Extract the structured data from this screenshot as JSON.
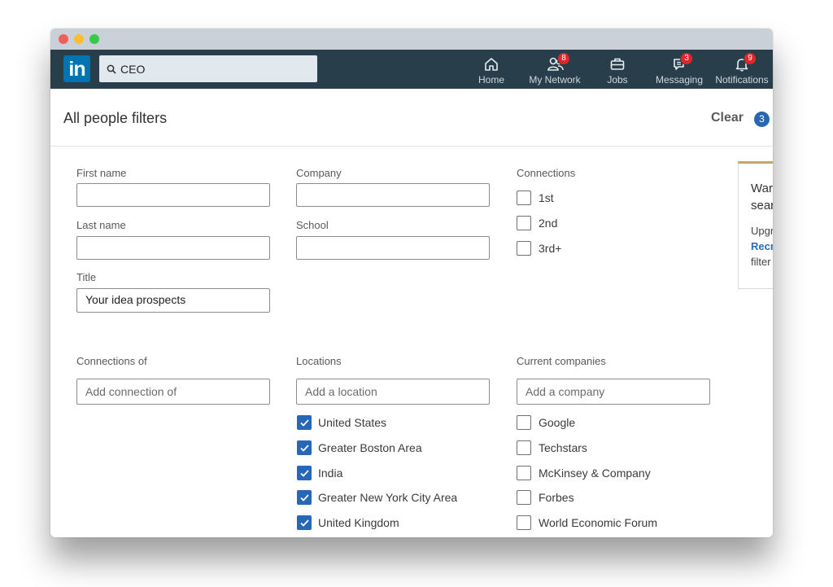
{
  "nav": {
    "logo_text": "in",
    "search_value": "CEO",
    "items": [
      {
        "label": "Home",
        "icon": "home-icon"
      },
      {
        "label": "My Network",
        "icon": "network-icon",
        "badge": "8"
      },
      {
        "label": "Jobs",
        "icon": "briefcase-icon"
      },
      {
        "label": "Messaging",
        "icon": "messaging-icon",
        "badge": "3"
      },
      {
        "label": "Notifications",
        "icon": "bell-icon",
        "badge": "9"
      }
    ],
    "colors": {
      "bar": "#283e4a",
      "logo": "#0073b1",
      "badge": "#e0262a"
    }
  },
  "header": {
    "title": "All people filters",
    "clear_label": "Clear",
    "clear_count": "3"
  },
  "fields": {
    "first_name_label": "First name",
    "last_name_label": "Last name",
    "title_label": "Title",
    "title_value": "Your idea prospects",
    "company_label": "Company",
    "school_label": "School"
  },
  "connections": {
    "label": "Connections",
    "options": [
      {
        "label": "1st",
        "checked": false
      },
      {
        "label": "2nd",
        "checked": false
      },
      {
        "label": "3rd+",
        "checked": false
      }
    ]
  },
  "connections_of": {
    "label": "Connections of",
    "placeholder": "Add connection of"
  },
  "locations": {
    "label": "Locations",
    "placeholder": "Add a location",
    "options": [
      {
        "label": "United States",
        "checked": true
      },
      {
        "label": "Greater Boston Area",
        "checked": true
      },
      {
        "label": "India",
        "checked": true
      },
      {
        "label": "Greater New York City Area",
        "checked": true
      },
      {
        "label": "United Kingdom",
        "checked": true
      }
    ]
  },
  "current_companies": {
    "label": "Current companies",
    "placeholder": "Add a company",
    "options": [
      {
        "label": "Google",
        "checked": false
      },
      {
        "label": "Techstars",
        "checked": false
      },
      {
        "label": "McKinsey & Company",
        "checked": false
      },
      {
        "label": "Forbes",
        "checked": false
      },
      {
        "label": "World Economic Forum",
        "checked": false
      }
    ]
  },
  "promo": {
    "line1": "War",
    "line2": "sear",
    "line3": "Upgr",
    "line4": "Recr",
    "line5": "filter"
  }
}
